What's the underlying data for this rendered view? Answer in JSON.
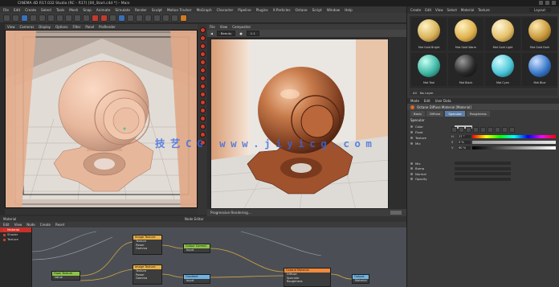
{
  "title_bar": {
    "text": "CINEMA 4D R17.032 Studio (RC – R17) [00_Start.c4d *] – Main"
  },
  "menubar": {
    "items": [
      "File",
      "Edit",
      "Create",
      "Select",
      "Tools",
      "Mesh",
      "Snap",
      "Animate",
      "Simulate",
      "Render",
      "Sculpt",
      "Motion Tracker",
      "MoGraph",
      "Character",
      "Pipeline",
      "Plugins",
      "X-Particles",
      "Octane",
      "Script",
      "Window",
      "Help"
    ]
  },
  "viewport": {
    "menu": [
      "View",
      "Cameras",
      "Display",
      "Options",
      "Filter",
      "Panel",
      "ProRender"
    ],
    "status": ""
  },
  "octane_viewer": {
    "menu": [
      "File",
      "View",
      "Compositor"
    ],
    "toolbar": {
      "select": "Beauty",
      "zoom": "1:1"
    },
    "status": "Progressive Rendering..."
  },
  "material_manager": {
    "menu": [
      "Create",
      "Edit",
      "View",
      "Select",
      "Material",
      "Texture"
    ],
    "layout_label": "Layout:",
    "materials": [
      {
        "label": "Mat Gold Bright",
        "color": "#d8b35a"
      },
      {
        "label": "Mat Gold Warm",
        "color": "#e0b24f"
      },
      {
        "label": "Mat Gold Light",
        "color": "#e5c06a"
      },
      {
        "label": "Mat Gold Dark",
        "color": "#c89a3d"
      },
      {
        "label": "Mat Teal",
        "color": "#3fb7a4"
      },
      {
        "label": "Mat Black",
        "color": "#2a2a2a"
      },
      {
        "label": "Mat Cyan",
        "color": "#4cc7d8"
      },
      {
        "label": "Mat Blue",
        "color": "#3a79c9"
      }
    ],
    "filter_row": [
      "All",
      "No Layer"
    ]
  },
  "attributes": {
    "menu": [
      "Mode",
      "Edit",
      "User Data"
    ],
    "title": "Octane Diffuse Material [Material]",
    "tabs": [
      "Basic",
      "Diffuse",
      "Specular",
      "Roughness",
      "Bump",
      "Normal",
      "Opacity"
    ],
    "active_tab": "Specular",
    "section": "Specular",
    "rows": [
      {
        "label": "Color"
      },
      {
        "label": "Float"
      },
      {
        "label": "Texture"
      },
      {
        "label": "Mix"
      }
    ],
    "color_values": [
      {
        "key": "H",
        "value": "27 °"
      },
      {
        "key": "S",
        "value": "0 %"
      },
      {
        "key": "V",
        "value": "60 %"
      }
    ],
    "extra_rows": [
      {
        "label": "Mix"
      },
      {
        "label": "Bump"
      },
      {
        "label": "Normal"
      },
      {
        "label": "Opacity"
      }
    ]
  },
  "node_editor": {
    "header_left": "Material",
    "header_center": "Node Editor",
    "menu": [
      "Edit",
      "View",
      "Node",
      "Create",
      "Reset"
    ],
    "list": [
      {
        "label": "Material",
        "selected": true
      },
      {
        "label": "Shader"
      },
      {
        "label": "Texture"
      }
    ],
    "nodes": [
      {
        "title": "Image Texture",
        "color": "#e8b043",
        "rows": [
          "Texture",
          "Power",
          "Gamma"
        ]
      },
      {
        "title": "Colour Correct",
        "color": "#8bc34a",
        "rows": [
          "Input"
        ]
      },
      {
        "title": "Image Texture",
        "color": "#e8b043",
        "rows": [
          "Texture",
          "Power",
          "Gamma"
        ]
      },
      {
        "title": "Gradient",
        "color": "#6db3e5",
        "rows": [
          "Input"
        ]
      },
      {
        "title": "Float Texture",
        "color": "#8bc34a",
        "rows": [
          "Value"
        ]
      },
      {
        "title": "Octane Material",
        "color": "#f08a3c",
        "rows": [
          "Diffuse",
          "Specular",
          "Roughness"
        ]
      },
      {
        "title": "Output",
        "color": "#6db3e5",
        "rows": [
          "Material"
        ]
      }
    ]
  },
  "watermark": {
    "text": "技艺CG www.jiyicg.com"
  },
  "colors": {
    "accent_red": "#c8302a",
    "copper": "#b8653e",
    "clay": "#e7b79c"
  }
}
